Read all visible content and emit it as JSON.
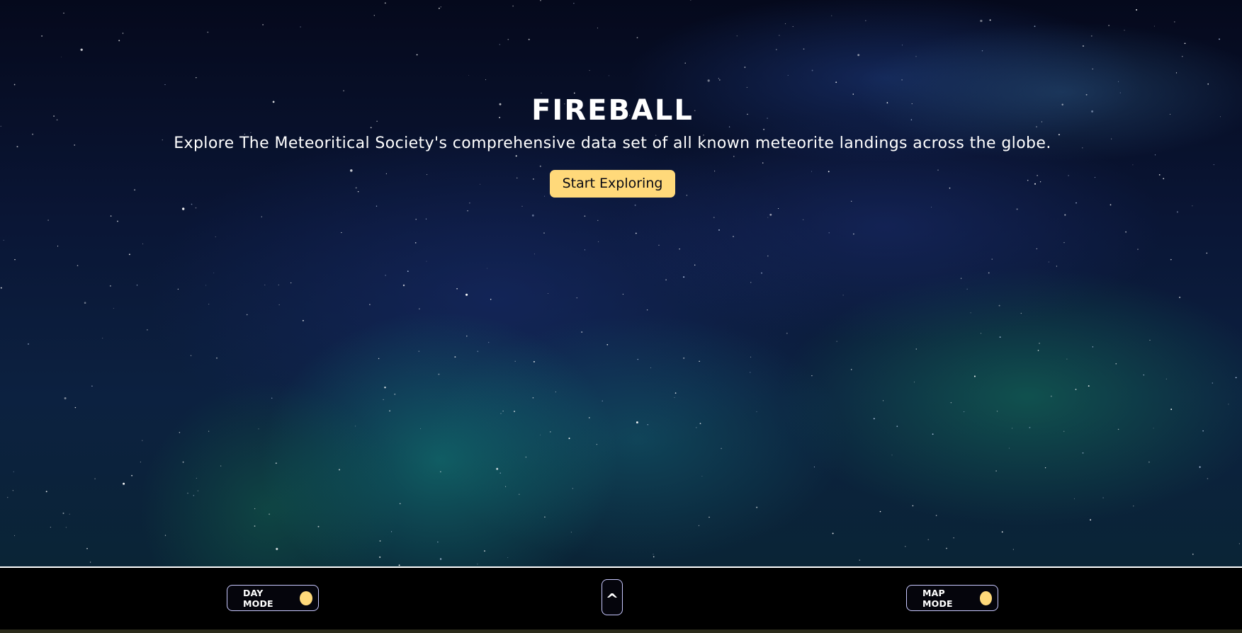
{
  "hero": {
    "title": "FIREBALL",
    "subtitle": "Explore The Meteoritical Society's comprehensive data set of all known meteorite landings across the globe.",
    "cta_label": "Start Exploring"
  },
  "footer": {
    "day_mode_label": "DAY MODE",
    "map_mode_label": "MAP MODE",
    "scroll_top_label": "^"
  },
  "colors": {
    "accent": "#ffd97a",
    "footer_background": "#000000",
    "toggle_border": "#c9c9ff",
    "text": "#ffffff"
  },
  "icons": {
    "day_mode_knob": "toggle-knob-icon",
    "map_mode_knob": "toggle-knob-icon",
    "scroll_top": "caret-up-icon"
  }
}
